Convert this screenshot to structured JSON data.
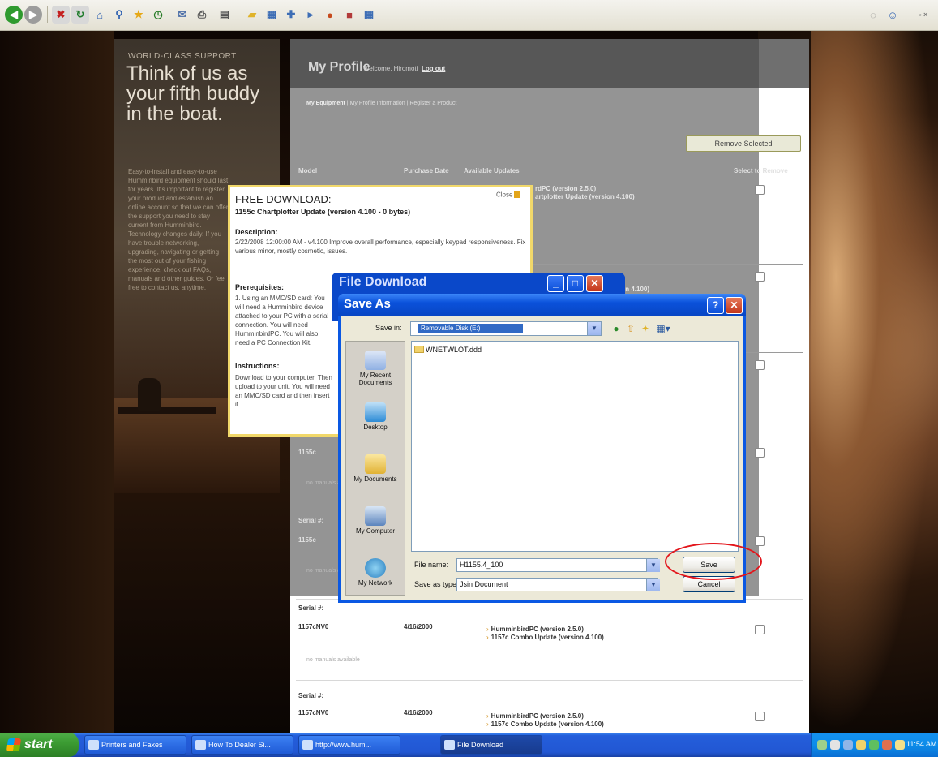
{
  "promo": {
    "eyebrow": "WORLD-CLASS SUPPORT",
    "title": "Think of us as your fifth buddy in the boat.",
    "body": "Easy-to-install and easy-to-use Humminbird equipment should last for years. It's important to register your product and establish an online account so that we can offer the support you need to stay current from Humminbird. Technology changes daily. If you have trouble networking, upgrading, navigating or getting the most out of your fishing experience, check out FAQs, manuals and other guides. Or feel free to contact us, anytime."
  },
  "profile": {
    "title": "My Profile",
    "welcome": "Welcome, Hiromoti",
    "logout": "Log out",
    "subnav": {
      "active": "My Equipment",
      "rest": "| My Profile Information | Register a Product"
    },
    "remove_button": "Remove Selected",
    "columns": {
      "model": "Model",
      "purchase_date": "Purchase Date",
      "available_updates": "Available Updates",
      "select": "Select to Remove"
    },
    "partial_rows": {
      "row1_a": "rdPC (version 2.5.0)",
      "row1_b": "artplotter Update (version 4.100)",
      "row2_a": "(version 4.100)",
      "model_row4": "1155c",
      "serial_label": "Serial #:",
      "model_row5": "1155c"
    },
    "manuals_text": "no manuals available",
    "rows": [
      {
        "serial": "Serial #:",
        "model": "1157cNV0",
        "date": "4/16/2000",
        "update1": "HumminbirdPC (version 2.5.0)",
        "update2": "1157c Combo Update (version 4.100)"
      },
      {
        "serial": "Serial #:",
        "model": "1157cNV0",
        "date": "4/16/2000",
        "update1": "HumminbirdPC (version 2.5.0)",
        "update2": "1157c Combo Update (version 4.100)"
      }
    ]
  },
  "free_download": {
    "title": "FREE DOWNLOAD:",
    "subtitle": "1155c Chartplotter Update (version 4.100 - 0 bytes)",
    "close": "Close",
    "description_h": "Description:",
    "description": "2/22/2008 12:00:00 AM - v4.100 Improve overall performance, especially keypad responsiveness. Fix various minor, mostly cosmetic, issues.",
    "prereq_h": "Prerequisites:",
    "prereq": "1. Using an MMC/SD card: You will need a Humminbird device attached to your PC with a serial connection. You will need HumminbirdPC. You will also need a PC Connection Kit.",
    "instr_h": "Instructions:",
    "instr": "Download to your computer. Then upload to your unit. You will need an MMC/SD card and then insert it."
  },
  "file_download": {
    "title": "File Download"
  },
  "save_as": {
    "title": "Save As",
    "save_in_label": "Save in:",
    "save_in_value": "Removable Disk (E:)",
    "places": [
      "My Recent Documents",
      "Desktop",
      "My Documents",
      "My Computer",
      "My Network"
    ],
    "files": [
      "WNETWLOT.ddd"
    ],
    "file_name_label": "File name:",
    "file_name_value": "H1155.4_100",
    "save_type_label": "Save as type:",
    "save_type_value": "Jsin Document",
    "save_button": "Save",
    "cancel_button": "Cancel"
  },
  "taskbar": {
    "start": "start",
    "tasks": [
      "Printers and Faxes",
      "How To Dealer Si...",
      "http://www.hum...",
      "File Download"
    ],
    "clock": "11:54 AM"
  },
  "colors": {
    "xp_blue": "#0a51da",
    "highlight_ring": "#e3151b",
    "popup_border": "#f1d86a"
  }
}
